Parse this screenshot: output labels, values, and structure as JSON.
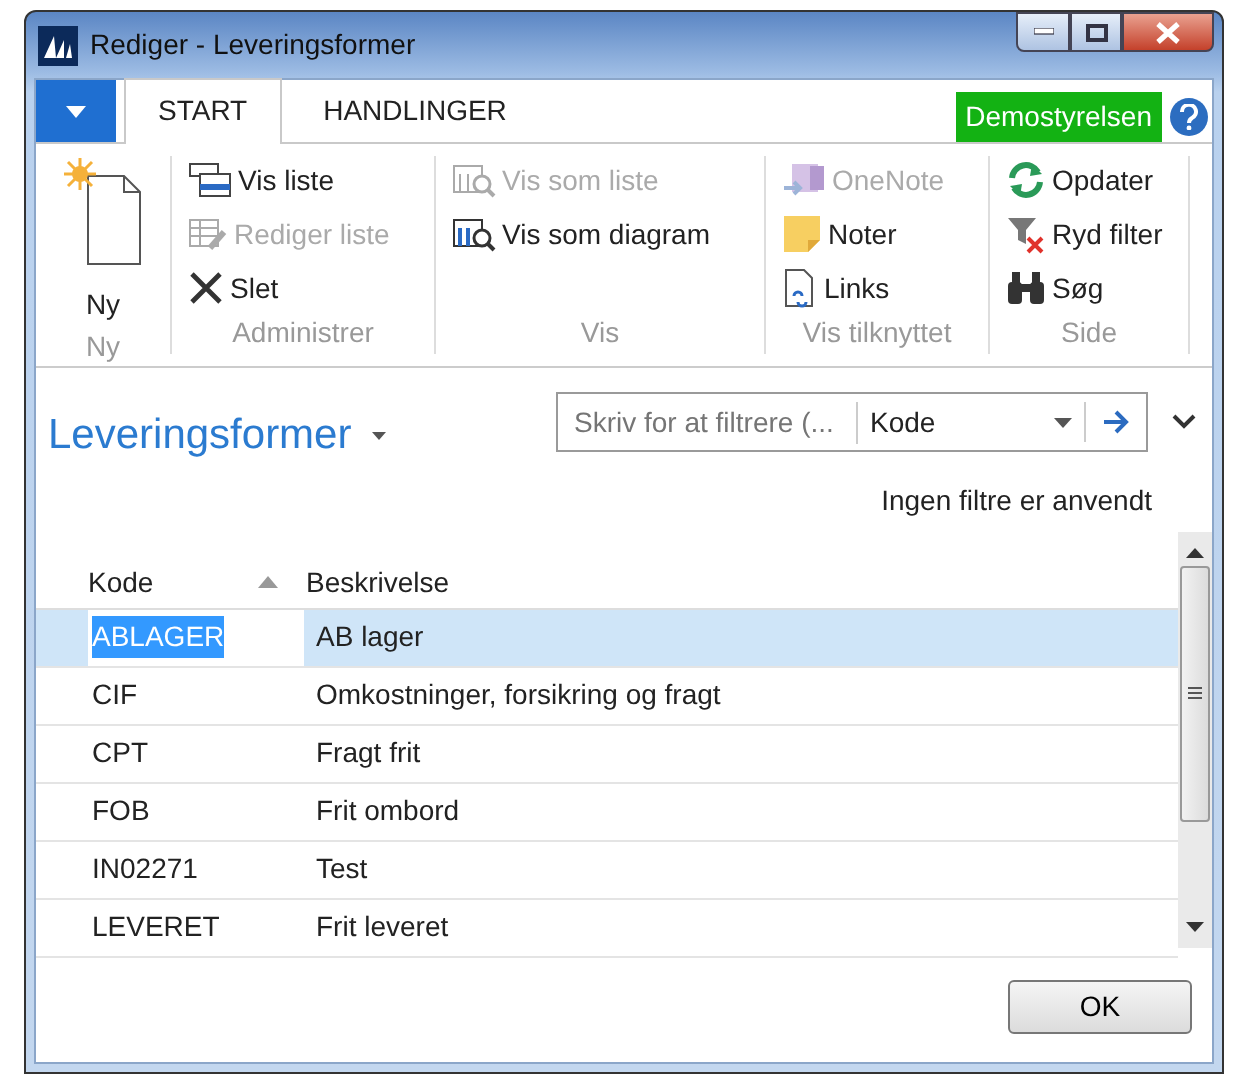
{
  "window": {
    "title": "Rediger - Leveringsformer"
  },
  "ribbon": {
    "tabs": [
      {
        "label": "START",
        "selected": true
      },
      {
        "label": "HANDLINGER",
        "selected": false
      }
    ],
    "company": "Demostyrelsen",
    "groups": [
      {
        "label": "Ny",
        "items": [
          {
            "label": "Ny",
            "disabled": false
          }
        ]
      },
      {
        "label": "Administrer",
        "items": [
          {
            "label": "Vis liste",
            "disabled": false
          },
          {
            "label": "Rediger liste",
            "disabled": true
          },
          {
            "label": "Slet",
            "disabled": false
          }
        ]
      },
      {
        "label": "Vis",
        "items": [
          {
            "label": "Vis som liste",
            "disabled": true
          },
          {
            "label": "Vis som diagram",
            "disabled": false
          }
        ]
      },
      {
        "label": "Vis tilknyttet",
        "items": [
          {
            "label": "OneNote",
            "disabled": true
          },
          {
            "label": "Noter",
            "disabled": false
          },
          {
            "label": "Links",
            "disabled": false
          }
        ]
      },
      {
        "label": "Side",
        "items": [
          {
            "label": "Opdater",
            "disabled": false
          },
          {
            "label": "Ryd filter",
            "disabled": false
          },
          {
            "label": "Søg",
            "disabled": false
          }
        ]
      }
    ]
  },
  "page": {
    "title": "Leveringsformer",
    "filter": {
      "placeholder": "Skriv for at filtrere (...",
      "field": "Kode"
    },
    "filter_status": "Ingen filtre er anvendt"
  },
  "table": {
    "columns": [
      {
        "label": "Kode",
        "sorted": true
      },
      {
        "label": "Beskrivelse",
        "sorted": false
      }
    ],
    "rows": [
      {
        "cells": [
          "ABLAGER",
          "AB lager"
        ],
        "selected": true
      },
      {
        "cells": [
          "CIF",
          "Omkostninger, forsikring og fragt"
        ],
        "selected": false
      },
      {
        "cells": [
          "CPT",
          "Fragt frit"
        ],
        "selected": false
      },
      {
        "cells": [
          "FOB",
          "Frit ombord"
        ],
        "selected": false
      },
      {
        "cells": [
          "IN02271",
          "Test"
        ],
        "selected": false
      },
      {
        "cells": [
          "LEVERET",
          "Frit leveret"
        ],
        "selected": false
      }
    ]
  },
  "buttons": [
    "OK"
  ]
}
